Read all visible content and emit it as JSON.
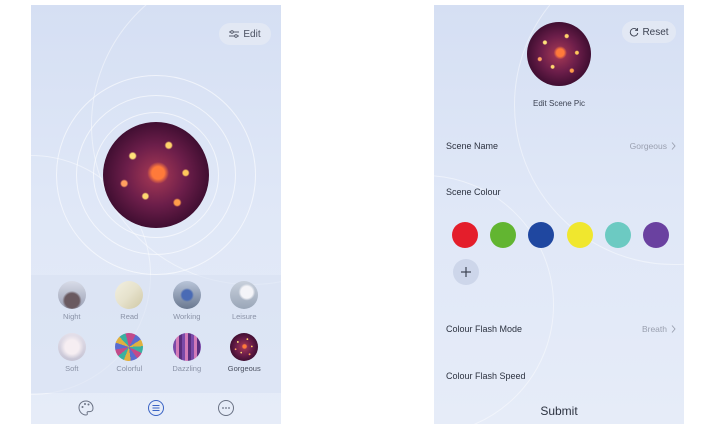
{
  "left_screen": {
    "edit_button": {
      "label": "Edit",
      "icon": "sliders-icon"
    },
    "current_scene_image": "fireworks",
    "scenes": [
      {
        "label": "Night",
        "thumb": "night"
      },
      {
        "label": "Read",
        "thumb": "read"
      },
      {
        "label": "Working",
        "thumb": "working"
      },
      {
        "label": "Leisure",
        "thumb": "leisure"
      },
      {
        "label": "Soft",
        "thumb": "soft"
      },
      {
        "label": "Colorful",
        "thumb": "colorful"
      },
      {
        "label": "Dazzling",
        "thumb": "dazzling"
      },
      {
        "label": "Gorgeous",
        "thumb": "fireworks",
        "selected": true
      }
    ],
    "bottom_nav": [
      {
        "icon": "palette-icon"
      },
      {
        "icon": "list-icon",
        "active": true
      },
      {
        "icon": "more-icon"
      }
    ]
  },
  "right_screen": {
    "reset_button": {
      "label": "Reset",
      "icon": "refresh-icon"
    },
    "edit_pic_label": "Edit Scene Pic",
    "scene_name": {
      "label": "Scene Name",
      "value": "Gorgeous"
    },
    "scene_colour": {
      "label": "Scene Colour",
      "colours": [
        "#e41e2b",
        "#62b531",
        "#1f47a0",
        "#f0e72e",
        "#6ccac2",
        "#6a41a0"
      ]
    },
    "colour_flash_mode": {
      "label": "Colour Flash Mode",
      "value": "Breath"
    },
    "colour_flash_speed": {
      "label": "Colour Flash Speed"
    },
    "submit_label": "Submit"
  },
  "colors": {
    "background": "#dfe7f7",
    "accent": "#3a63c4"
  }
}
